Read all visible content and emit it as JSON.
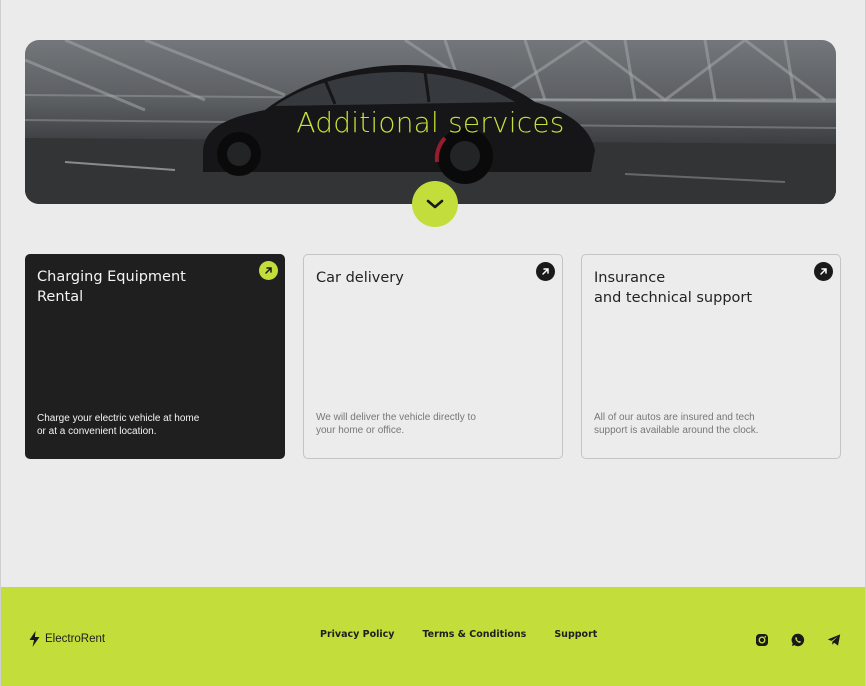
{
  "hero": {
    "title": "Additional services"
  },
  "cards": [
    {
      "title": "Charging Equipment\nRental",
      "description": "Charge your electric vehicle at home or at a convenient location.",
      "variant": "dark"
    },
    {
      "title": "Car delivery",
      "description": "We will deliver the vehicle directly to your home or office.",
      "variant": "light"
    },
    {
      "title": "Insurance\nand technical support",
      "description": "All of our autos are insured and tech support is available around the clock.",
      "variant": "light"
    }
  ],
  "footer": {
    "brand": "ElectroRent",
    "links": [
      "Privacy Policy",
      "Terms & Conditions",
      "Support"
    ],
    "socials": [
      "instagram-icon",
      "whatsapp-icon",
      "telegram-icon"
    ]
  },
  "colors": {
    "accent": "#c3dd3a",
    "dark_card": "#1f1f1f",
    "background": "#ebebeb"
  }
}
